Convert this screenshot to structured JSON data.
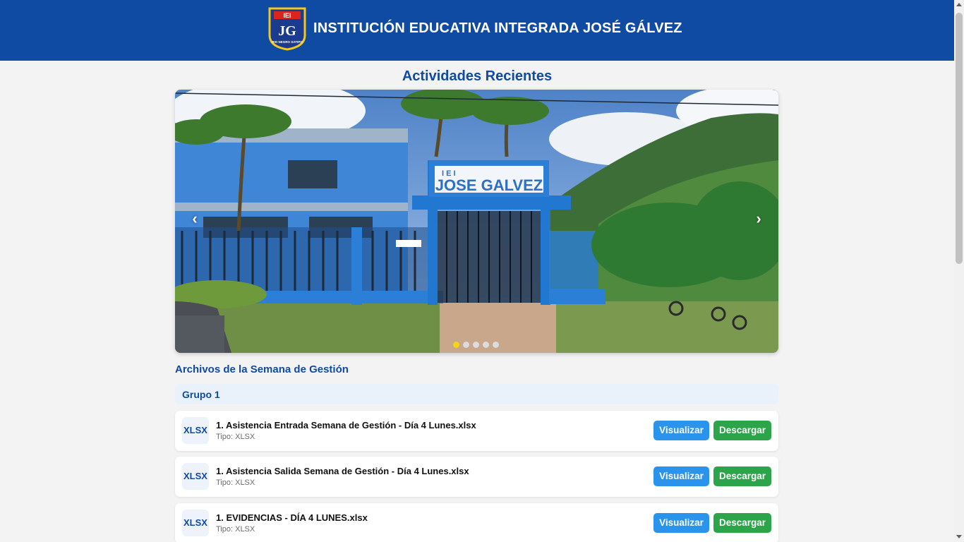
{
  "header": {
    "title": "INSTITUCIÓN EDUCATIVA INTEGRADA JOSÉ GÁLVEZ",
    "logo_initials": "JG",
    "logo_top_text": "IEI",
    "logo_bottom_text": "RIO NEGRO SATIPO",
    "background_color": "#0f4aa3"
  },
  "activities": {
    "title": "Actividades Recientes",
    "carousel": {
      "prev_icon": "chevron-left-icon",
      "next_icon": "chevron-right-icon",
      "prev_glyph": "‹",
      "next_glyph": "›",
      "photo_sign_top": "I E I",
      "photo_sign_main": "JOSE GALVEZ",
      "slide_count": 5,
      "active_slide": 1
    }
  },
  "files": {
    "title": "Archivos de la Semana de Gestión",
    "group": "Grupo 1",
    "view_label": "Visualizar",
    "download_label": "Descargar",
    "items": [
      {
        "badge": "XLSX",
        "name": "1. Asistencia Entrada Semana de Gestión - Día 4 Lunes.xlsx",
        "type": "Tipo: XLSX"
      },
      {
        "badge": "XLSX",
        "name": "1. Asistencia Salida Semana de Gestión - Día 4 Lunes.xlsx",
        "type": "Tipo: XLSX"
      },
      {
        "badge": "XLSX",
        "name": "1. EVIDENCIAS - DÍA 4 LUNES.xlsx",
        "type": "Tipo: XLSX"
      }
    ]
  },
  "colors": {
    "accent": "#0f4aa3",
    "view_button": "#2a93eb",
    "download_button": "#2ca44a",
    "active_dot": "#f5d416"
  }
}
